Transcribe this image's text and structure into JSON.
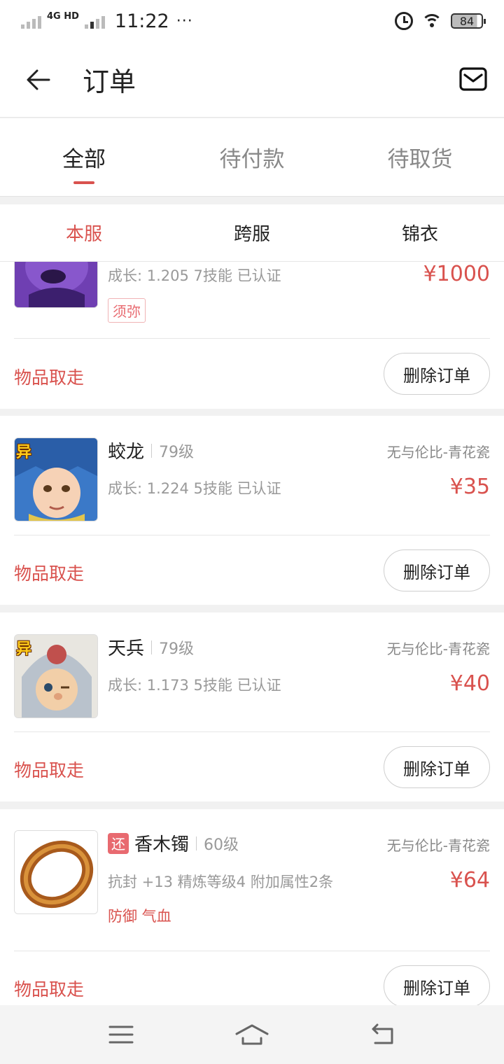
{
  "status_bar": {
    "network": "4G HD",
    "time": "11:22",
    "dots": "···",
    "battery": "84"
  },
  "header": {
    "title": "订单",
    "back_icon": "arrow-left-icon",
    "mail_icon": "mail-icon"
  },
  "main_tabs": [
    {
      "label": "全部",
      "active": true
    },
    {
      "label": "待付款",
      "active": false
    },
    {
      "label": "待取货",
      "active": false
    }
  ],
  "sub_tabs": [
    {
      "label": "本服",
      "active": true
    },
    {
      "label": "跨服",
      "active": false
    },
    {
      "label": "锦衣",
      "active": false
    }
  ],
  "orders": [
    {
      "name": "",
      "stats": "成长: 1.205  7技能  已认证",
      "price": "¥1000",
      "tag": "须弥",
      "status": "物品取走",
      "action": "删除订单"
    },
    {
      "name": "蛟龙",
      "level": "79级",
      "server": "无与伦比-青花瓷",
      "stats": "成长: 1.224  5技能  已认证",
      "price": "¥35",
      "badge": "异",
      "status": "物品取走",
      "action": "删除订单"
    },
    {
      "name": "天兵",
      "level": "79级",
      "server": "无与伦比-青花瓷",
      "stats": "成长: 1.173  5技能  已认证",
      "price": "¥40",
      "badge": "异",
      "status": "物品取走",
      "action": "删除订单"
    },
    {
      "tag": "还",
      "name": "香木镯",
      "level": "60级",
      "server": "无与伦比-青花瓷",
      "stats": "抗封 +13  精炼等级4  附加属性2条",
      "attrs": "防御 气血",
      "price": "¥64",
      "status": "物品取走",
      "action": "删除订单"
    }
  ],
  "system_nav": {
    "menu_icon": "menu-icon",
    "home_icon": "home-icon",
    "back_icon": "back-icon"
  }
}
